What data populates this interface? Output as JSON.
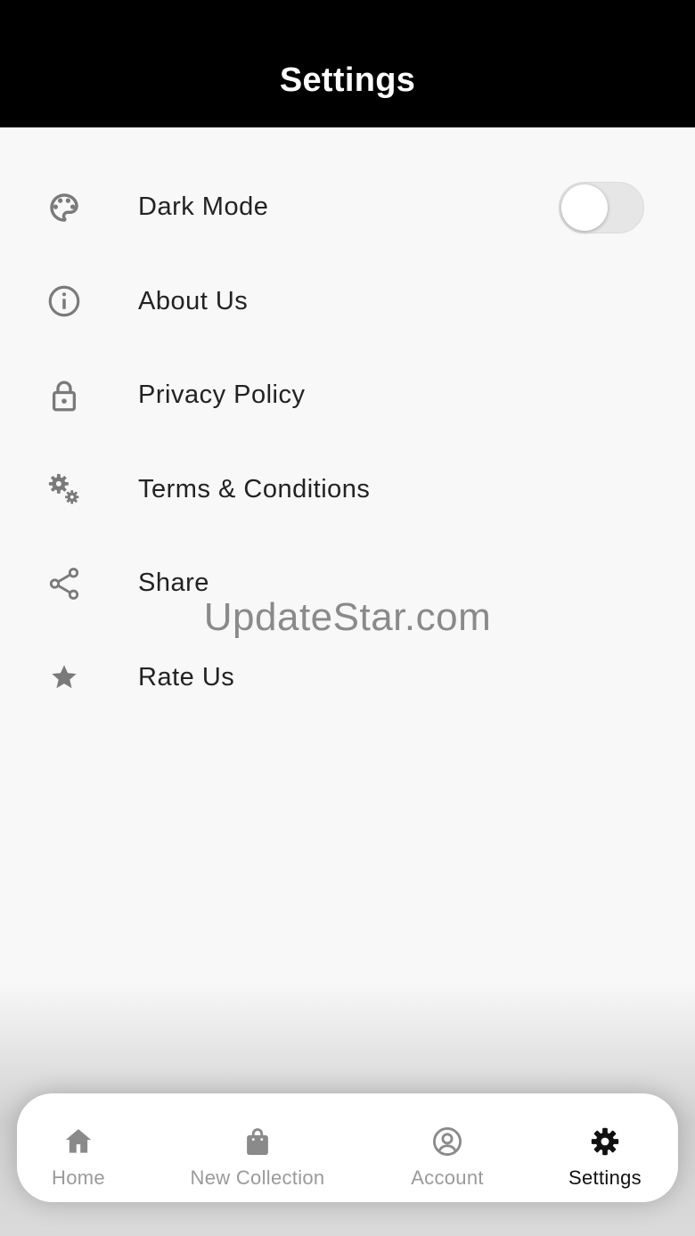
{
  "app_bar": {
    "title": "Settings"
  },
  "settings": [
    {
      "label": "Dark Mode",
      "icon": "palette-icon",
      "toggle": {
        "on": false
      }
    },
    {
      "label": "About Us",
      "icon": "info-icon"
    },
    {
      "label": "Privacy Policy",
      "icon": "lock-icon"
    },
    {
      "label": "Terms & Conditions",
      "icon": "gears-icon"
    },
    {
      "label": "Share",
      "icon": "share-icon"
    },
    {
      "label": "Rate Us",
      "icon": "star-icon"
    }
  ],
  "watermark": "UpdateStar.com",
  "bottom_nav": {
    "active": "Settings",
    "items": [
      {
        "label": "Home",
        "icon": "home-icon"
      },
      {
        "label": "New Collection",
        "icon": "shopping-bag-icon"
      },
      {
        "label": "Account",
        "icon": "account-circle-icon"
      },
      {
        "label": "Settings",
        "icon": "gear-icon"
      }
    ]
  },
  "colors": {
    "app_bar_bg": "#000000",
    "background": "#f8f8f8",
    "icon_gray": "#7a7a7a",
    "nav_inactive": "#9a9a9a",
    "nav_active": "#111111"
  }
}
